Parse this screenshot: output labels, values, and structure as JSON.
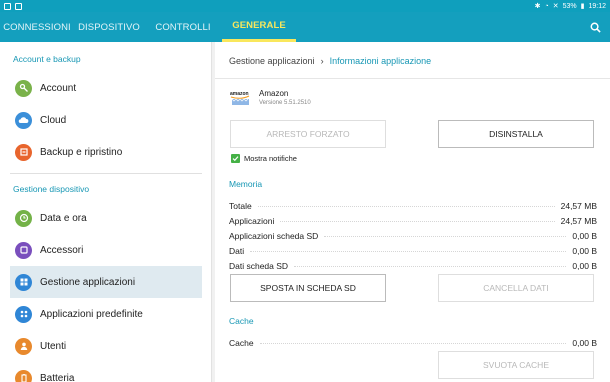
{
  "status_bar": {
    "battery": "53%",
    "time": "19:12"
  },
  "tabs": [
    {
      "label": "Connessioni"
    },
    {
      "label": "Dispositivo"
    },
    {
      "label": "Controlli"
    },
    {
      "label": "Generale",
      "active": true
    }
  ],
  "sidebar": {
    "sections": [
      {
        "title": "Account e backup",
        "items": [
          {
            "label": "Account",
            "icon": "key-icon",
            "color": "#7ab24a"
          },
          {
            "label": "Cloud",
            "icon": "cloud-icon",
            "color": "#3b8fd9"
          },
          {
            "label": "Backup e ripristino",
            "icon": "backup-icon",
            "color": "#e8652d"
          }
        ]
      },
      {
        "title": "Gestione dispositivo",
        "items": [
          {
            "label": "Data e ora",
            "icon": "clock-icon",
            "color": "#74b248"
          },
          {
            "label": "Accessori",
            "icon": "accessory-icon",
            "color": "#7a4fbd"
          },
          {
            "label": "Gestione applicazioni",
            "icon": "apps-grid-icon",
            "color": "#2f86d6",
            "selected": true
          },
          {
            "label": "Applicazioni predefinite",
            "icon": "default-apps-icon",
            "color": "#2f86d6"
          },
          {
            "label": "Utenti",
            "icon": "user-icon",
            "color": "#e8892d"
          },
          {
            "label": "Batteria",
            "icon": "battery-icon",
            "color": "#e8892d"
          }
        ]
      }
    ]
  },
  "main": {
    "breadcrumb": {
      "parent": "Gestione applicazioni",
      "current": "Informazioni applicazione"
    },
    "app": {
      "name": "Amazon",
      "version": "Versione 5.51.2510",
      "logo_text": "amazon"
    },
    "buttons": {
      "force_stop": "Arresto forzato",
      "uninstall": "Disinstalla",
      "move_sd": "Sposta in scheda SD",
      "clear_data": "Cancella dati",
      "clear_cache": "Svuota cache"
    },
    "notifications_label": "Mostra notifiche",
    "memory": {
      "title": "Memoria",
      "rows": [
        {
          "label": "Totale",
          "value": "24,57 MB"
        },
        {
          "label": "Applicazioni",
          "value": "24,57 MB"
        },
        {
          "label": "Applicazioni scheda SD",
          "value": "0,00 B"
        },
        {
          "label": "Dati",
          "value": "0,00 B"
        },
        {
          "label": "Dati scheda SD",
          "value": "0,00 B"
        }
      ]
    },
    "cache": {
      "title": "Cache",
      "rows": [
        {
          "label": "Cache",
          "value": "0,00 B"
        }
      ]
    }
  }
}
